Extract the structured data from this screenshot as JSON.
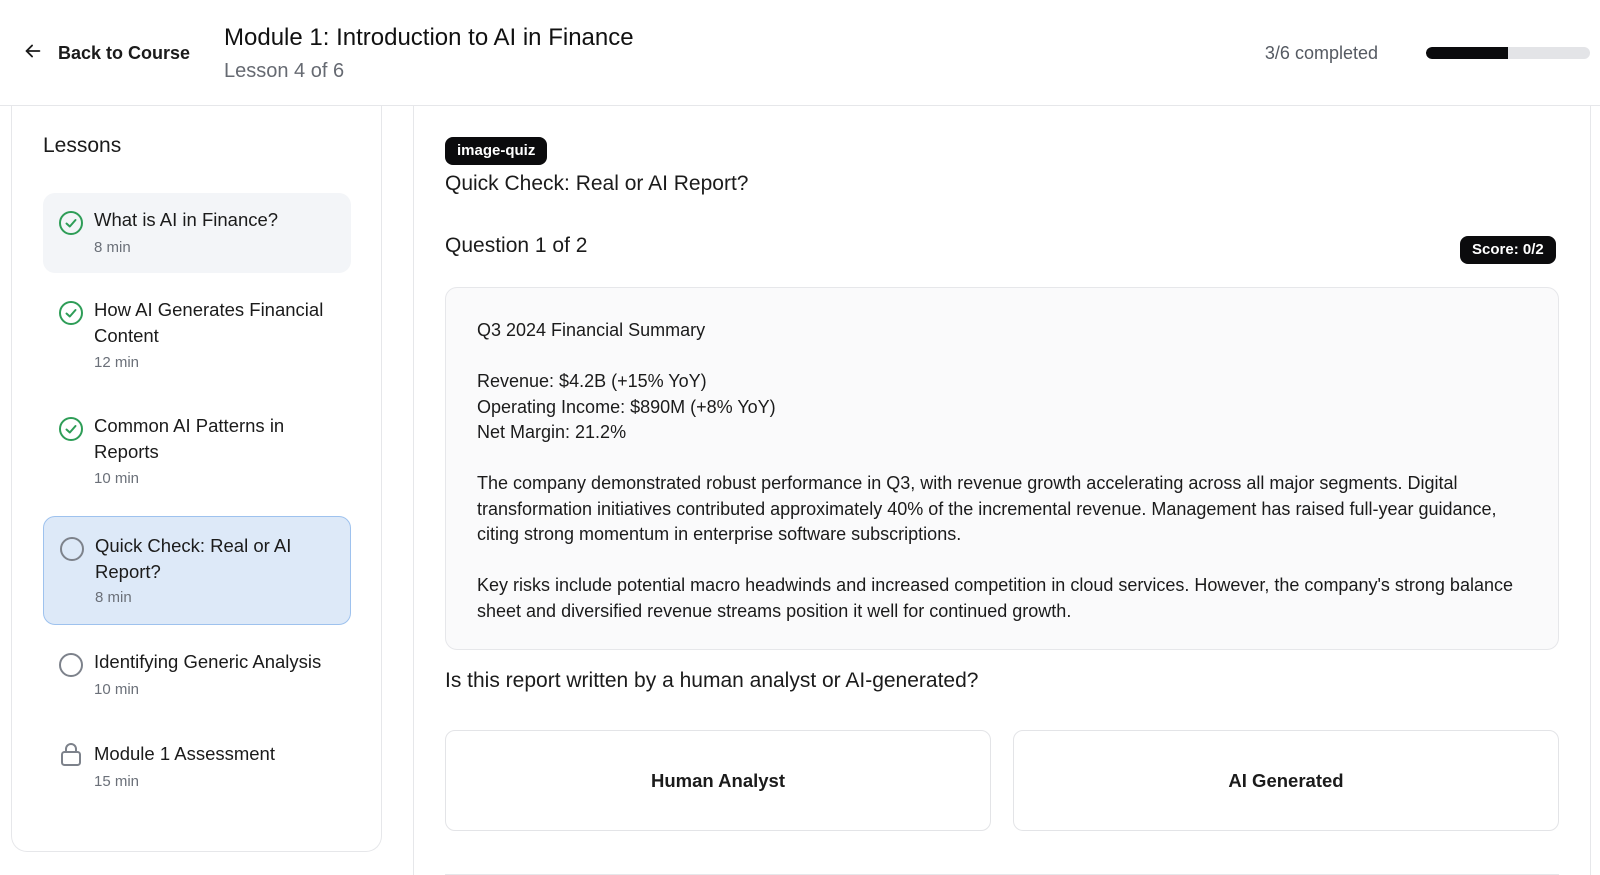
{
  "header": {
    "back_label": "Back to Course",
    "module_title": "Module 1: Introduction to AI in Finance",
    "lesson_position": "Lesson 4 of 6",
    "progress_text": "3/6 completed",
    "progress_fraction": 0.5
  },
  "sidebar": {
    "title": "Lessons",
    "lessons": [
      {
        "name": "What is AI in Finance?",
        "duration": "8 min",
        "status": "completed",
        "icon": "check-circle-icon"
      },
      {
        "name": "How AI Generates Financial Content",
        "duration": "12 min",
        "status": "completed",
        "icon": "check-circle-icon"
      },
      {
        "name": "Common AI Patterns in Reports",
        "duration": "10 min",
        "status": "completed",
        "icon": "check-circle-icon"
      },
      {
        "name": "Quick Check: Real or AI Report?",
        "duration": "8 min",
        "status": "current",
        "icon": "empty-circle-icon"
      },
      {
        "name": "Identifying Generic Analysis",
        "duration": "10 min",
        "status": "not-started",
        "icon": "empty-circle-icon"
      },
      {
        "name": "Module 1 Assessment",
        "duration": "15 min",
        "status": "locked",
        "icon": "lock-icon"
      }
    ]
  },
  "main": {
    "tag": "image-quiz",
    "lesson_title": "Quick Check: Real or AI Report?",
    "question_counter": "Question 1 of 2",
    "score": "Score: 0/2",
    "report": {
      "title": "Q3 2024 Financial Summary",
      "revenue": "Revenue: $4.2B (+15% YoY)",
      "operating_income": "Operating Income: $890M (+8% YoY)",
      "net_margin": "Net Margin: 21.2%",
      "paragraph1": "The company demonstrated robust performance in Q3, with revenue growth accelerating across all major segments. Digital transformation initiatives contributed approximately 40% of the incremental revenue. Management has raised full-year guidance, citing strong momentum in enterprise software subscriptions.",
      "paragraph2": "Key risks include potential macro headwinds and increased competition in cloud services. However, the company's strong balance sheet and diversified revenue streams position it well for continued growth."
    },
    "prompt": "Is this report written by a human analyst or AI-generated?",
    "options": [
      "Human Analyst",
      "AI Generated"
    ]
  },
  "colors": {
    "accent_dark": "#0b0b0d",
    "completed_green": "#2e9d57",
    "current_bg": "#dde9f8",
    "current_border": "#9ec2ee"
  }
}
